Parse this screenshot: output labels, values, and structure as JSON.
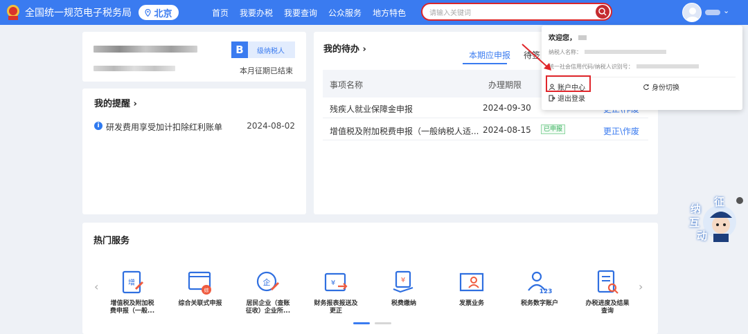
{
  "header": {
    "site_title": "全国统一规范电子税务局",
    "region": "北京",
    "nav": [
      "首页",
      "我要办税",
      "我要查询",
      "公众服务",
      "地方特色"
    ],
    "search_placeholder": "请输入关键词"
  },
  "account_card": {
    "level_letter": "B",
    "level_label": "级纳税人",
    "period_status": "本月征期已结束"
  },
  "reminders": {
    "title": "我的提醒 ›",
    "items": [
      {
        "text": "研发费用享受加计扣除红利账单",
        "date": "2024-08-02"
      }
    ]
  },
  "todos": {
    "title": "我的待办 ›",
    "tabs": [
      "本期应申报",
      "待签"
    ],
    "columns": [
      "事项名称",
      "办理期限"
    ],
    "rows": [
      {
        "name": "残疾人就业保障金申报",
        "deadline": "2024-09-30",
        "status": "",
        "action": "更正\\作废"
      },
      {
        "name": "增值税及附加税费申报（一般纳税人适...",
        "deadline": "2024-08-15",
        "status": "已申报",
        "action": "更正\\作废"
      }
    ]
  },
  "user_menu": {
    "welcome": "欢迎您，",
    "taxpayer_label": "纳税人名称：",
    "credit_code_label": "统一社会信用代码/纳税人识别号：",
    "account_center": "账户中心",
    "switch_identity": "身份切换",
    "logout": "退出登录"
  },
  "hot_services": {
    "title": "热门服务",
    "items": [
      {
        "line1": "增值税及附加税",
        "line2": "费申报（一般..."
      },
      {
        "line1": "综合关联式申报",
        "line2": ""
      },
      {
        "line1": "居民企业（查账",
        "line2": "征收）企业所..."
      },
      {
        "line1": "财务报表报送及",
        "line2": "更正"
      },
      {
        "line1": "税费缴纳",
        "line2": ""
      },
      {
        "line1": "发票业务",
        "line2": ""
      },
      {
        "line1": "税务数字账户",
        "line2": ""
      },
      {
        "line1": "办税进度及结果",
        "line2": "查询"
      }
    ]
  },
  "mascot": {
    "chars": [
      "征",
      "纳",
      "互",
      "动"
    ]
  },
  "colors": {
    "brand": "#3a7bf0",
    "highlight": "#e0262b",
    "success": "#35b05a"
  }
}
